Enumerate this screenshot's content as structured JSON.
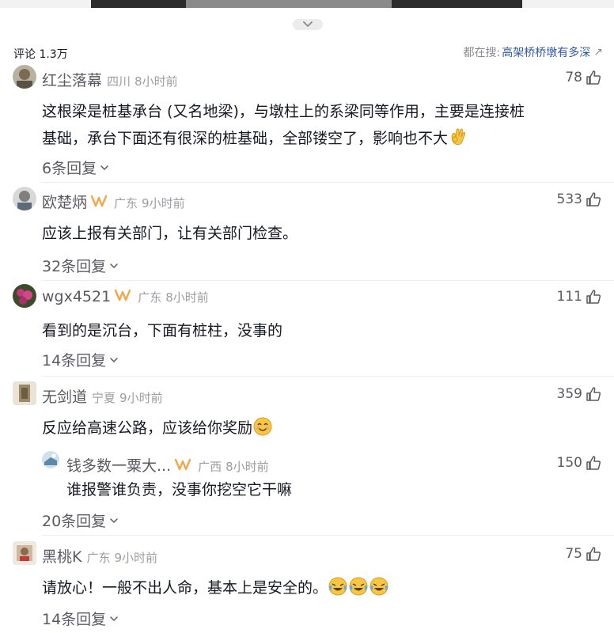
{
  "header": {
    "comment_count": "评论 1.3万",
    "search_prefix": "都在搜:",
    "search_term": "高架桥桥墩有多深",
    "search_arrow": "↗"
  },
  "colors": {
    "accent_link": "#2f56a6",
    "badge": "#f2a74a",
    "meta_gray": "#9c9ca3"
  },
  "comments": [
    {
      "username": "红尘落幕",
      "location": "四川",
      "time": "8小时前",
      "likes": "78",
      "text_line1": "这根梁是桩基承台 (又名地梁)，与墩柱上的系梁同等作用，主要是连接桩",
      "text_line2": "基础，承台下面还有很深的桩基础，全部镂空了，影响也不大",
      "emoji": "ok-hand-emoji",
      "replies": "6条回复"
    },
    {
      "username": "欧楚炳",
      "location": "广东",
      "time": "9小时前",
      "likes": "533",
      "text": "应该上报有关部门，让有关部门检查。",
      "replies": "32条回复"
    },
    {
      "username": "wgx4521",
      "location": "广东",
      "time": "8小时前",
      "likes": "111",
      "text": "看到的是沉台，下面有桩柱，没事的",
      "replies": "14条回复"
    },
    {
      "username": "无剑道",
      "location": "宁夏",
      "time": "9小时前",
      "likes": "359",
      "text": "反应给高速公路，应该给你奖励",
      "emoji": "smile-emoji",
      "reply_preview": {
        "username": "钱多数一粟大...",
        "location": "广西",
        "time": "8小时前",
        "likes": "150",
        "text": "谁报警谁负责，没事你挖空它干嘛"
      },
      "replies": "20条回复"
    },
    {
      "username": "黑桃K",
      "location": "广东",
      "time": "9小时前",
      "likes": "75",
      "text": "请放心！一般不出人命，基本上是安全的。",
      "emoji": "laugh-cry-emoji",
      "replies": "14条回复"
    }
  ]
}
